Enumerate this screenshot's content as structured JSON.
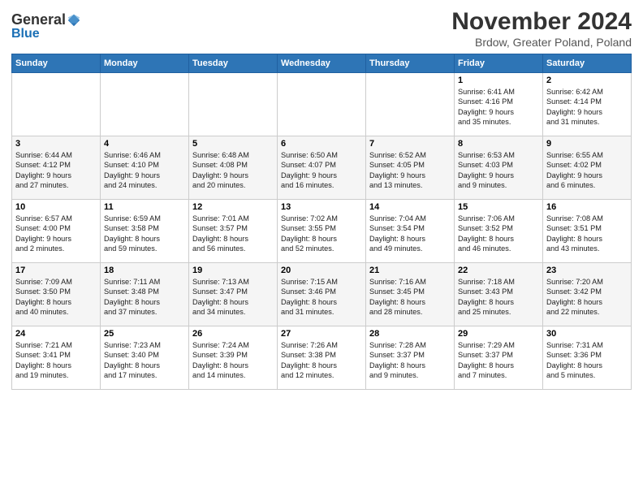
{
  "logo": {
    "general": "General",
    "blue": "Blue"
  },
  "header": {
    "month": "November 2024",
    "location": "Brdow, Greater Poland, Poland"
  },
  "weekdays": [
    "Sunday",
    "Monday",
    "Tuesday",
    "Wednesday",
    "Thursday",
    "Friday",
    "Saturday"
  ],
  "weeks": [
    [
      {
        "day": "",
        "info": ""
      },
      {
        "day": "",
        "info": ""
      },
      {
        "day": "",
        "info": ""
      },
      {
        "day": "",
        "info": ""
      },
      {
        "day": "",
        "info": ""
      },
      {
        "day": "1",
        "info": "Sunrise: 6:41 AM\nSunset: 4:16 PM\nDaylight: 9 hours\nand 35 minutes."
      },
      {
        "day": "2",
        "info": "Sunrise: 6:42 AM\nSunset: 4:14 PM\nDaylight: 9 hours\nand 31 minutes."
      }
    ],
    [
      {
        "day": "3",
        "info": "Sunrise: 6:44 AM\nSunset: 4:12 PM\nDaylight: 9 hours\nand 27 minutes."
      },
      {
        "day": "4",
        "info": "Sunrise: 6:46 AM\nSunset: 4:10 PM\nDaylight: 9 hours\nand 24 minutes."
      },
      {
        "day": "5",
        "info": "Sunrise: 6:48 AM\nSunset: 4:08 PM\nDaylight: 9 hours\nand 20 minutes."
      },
      {
        "day": "6",
        "info": "Sunrise: 6:50 AM\nSunset: 4:07 PM\nDaylight: 9 hours\nand 16 minutes."
      },
      {
        "day": "7",
        "info": "Sunrise: 6:52 AM\nSunset: 4:05 PM\nDaylight: 9 hours\nand 13 minutes."
      },
      {
        "day": "8",
        "info": "Sunrise: 6:53 AM\nSunset: 4:03 PM\nDaylight: 9 hours\nand 9 minutes."
      },
      {
        "day": "9",
        "info": "Sunrise: 6:55 AM\nSunset: 4:02 PM\nDaylight: 9 hours\nand 6 minutes."
      }
    ],
    [
      {
        "day": "10",
        "info": "Sunrise: 6:57 AM\nSunset: 4:00 PM\nDaylight: 9 hours\nand 2 minutes."
      },
      {
        "day": "11",
        "info": "Sunrise: 6:59 AM\nSunset: 3:58 PM\nDaylight: 8 hours\nand 59 minutes."
      },
      {
        "day": "12",
        "info": "Sunrise: 7:01 AM\nSunset: 3:57 PM\nDaylight: 8 hours\nand 56 minutes."
      },
      {
        "day": "13",
        "info": "Sunrise: 7:02 AM\nSunset: 3:55 PM\nDaylight: 8 hours\nand 52 minutes."
      },
      {
        "day": "14",
        "info": "Sunrise: 7:04 AM\nSunset: 3:54 PM\nDaylight: 8 hours\nand 49 minutes."
      },
      {
        "day": "15",
        "info": "Sunrise: 7:06 AM\nSunset: 3:52 PM\nDaylight: 8 hours\nand 46 minutes."
      },
      {
        "day": "16",
        "info": "Sunrise: 7:08 AM\nSunset: 3:51 PM\nDaylight: 8 hours\nand 43 minutes."
      }
    ],
    [
      {
        "day": "17",
        "info": "Sunrise: 7:09 AM\nSunset: 3:50 PM\nDaylight: 8 hours\nand 40 minutes."
      },
      {
        "day": "18",
        "info": "Sunrise: 7:11 AM\nSunset: 3:48 PM\nDaylight: 8 hours\nand 37 minutes."
      },
      {
        "day": "19",
        "info": "Sunrise: 7:13 AM\nSunset: 3:47 PM\nDaylight: 8 hours\nand 34 minutes."
      },
      {
        "day": "20",
        "info": "Sunrise: 7:15 AM\nSunset: 3:46 PM\nDaylight: 8 hours\nand 31 minutes."
      },
      {
        "day": "21",
        "info": "Sunrise: 7:16 AM\nSunset: 3:45 PM\nDaylight: 8 hours\nand 28 minutes."
      },
      {
        "day": "22",
        "info": "Sunrise: 7:18 AM\nSunset: 3:43 PM\nDaylight: 8 hours\nand 25 minutes."
      },
      {
        "day": "23",
        "info": "Sunrise: 7:20 AM\nSunset: 3:42 PM\nDaylight: 8 hours\nand 22 minutes."
      }
    ],
    [
      {
        "day": "24",
        "info": "Sunrise: 7:21 AM\nSunset: 3:41 PM\nDaylight: 8 hours\nand 19 minutes."
      },
      {
        "day": "25",
        "info": "Sunrise: 7:23 AM\nSunset: 3:40 PM\nDaylight: 8 hours\nand 17 minutes."
      },
      {
        "day": "26",
        "info": "Sunrise: 7:24 AM\nSunset: 3:39 PM\nDaylight: 8 hours\nand 14 minutes."
      },
      {
        "day": "27",
        "info": "Sunrise: 7:26 AM\nSunset: 3:38 PM\nDaylight: 8 hours\nand 12 minutes."
      },
      {
        "day": "28",
        "info": "Sunrise: 7:28 AM\nSunset: 3:37 PM\nDaylight: 8 hours\nand 9 minutes."
      },
      {
        "day": "29",
        "info": "Sunrise: 7:29 AM\nSunset: 3:37 PM\nDaylight: 8 hours\nand 7 minutes."
      },
      {
        "day": "30",
        "info": "Sunrise: 7:31 AM\nSunset: 3:36 PM\nDaylight: 8 hours\nand 5 minutes."
      }
    ]
  ]
}
